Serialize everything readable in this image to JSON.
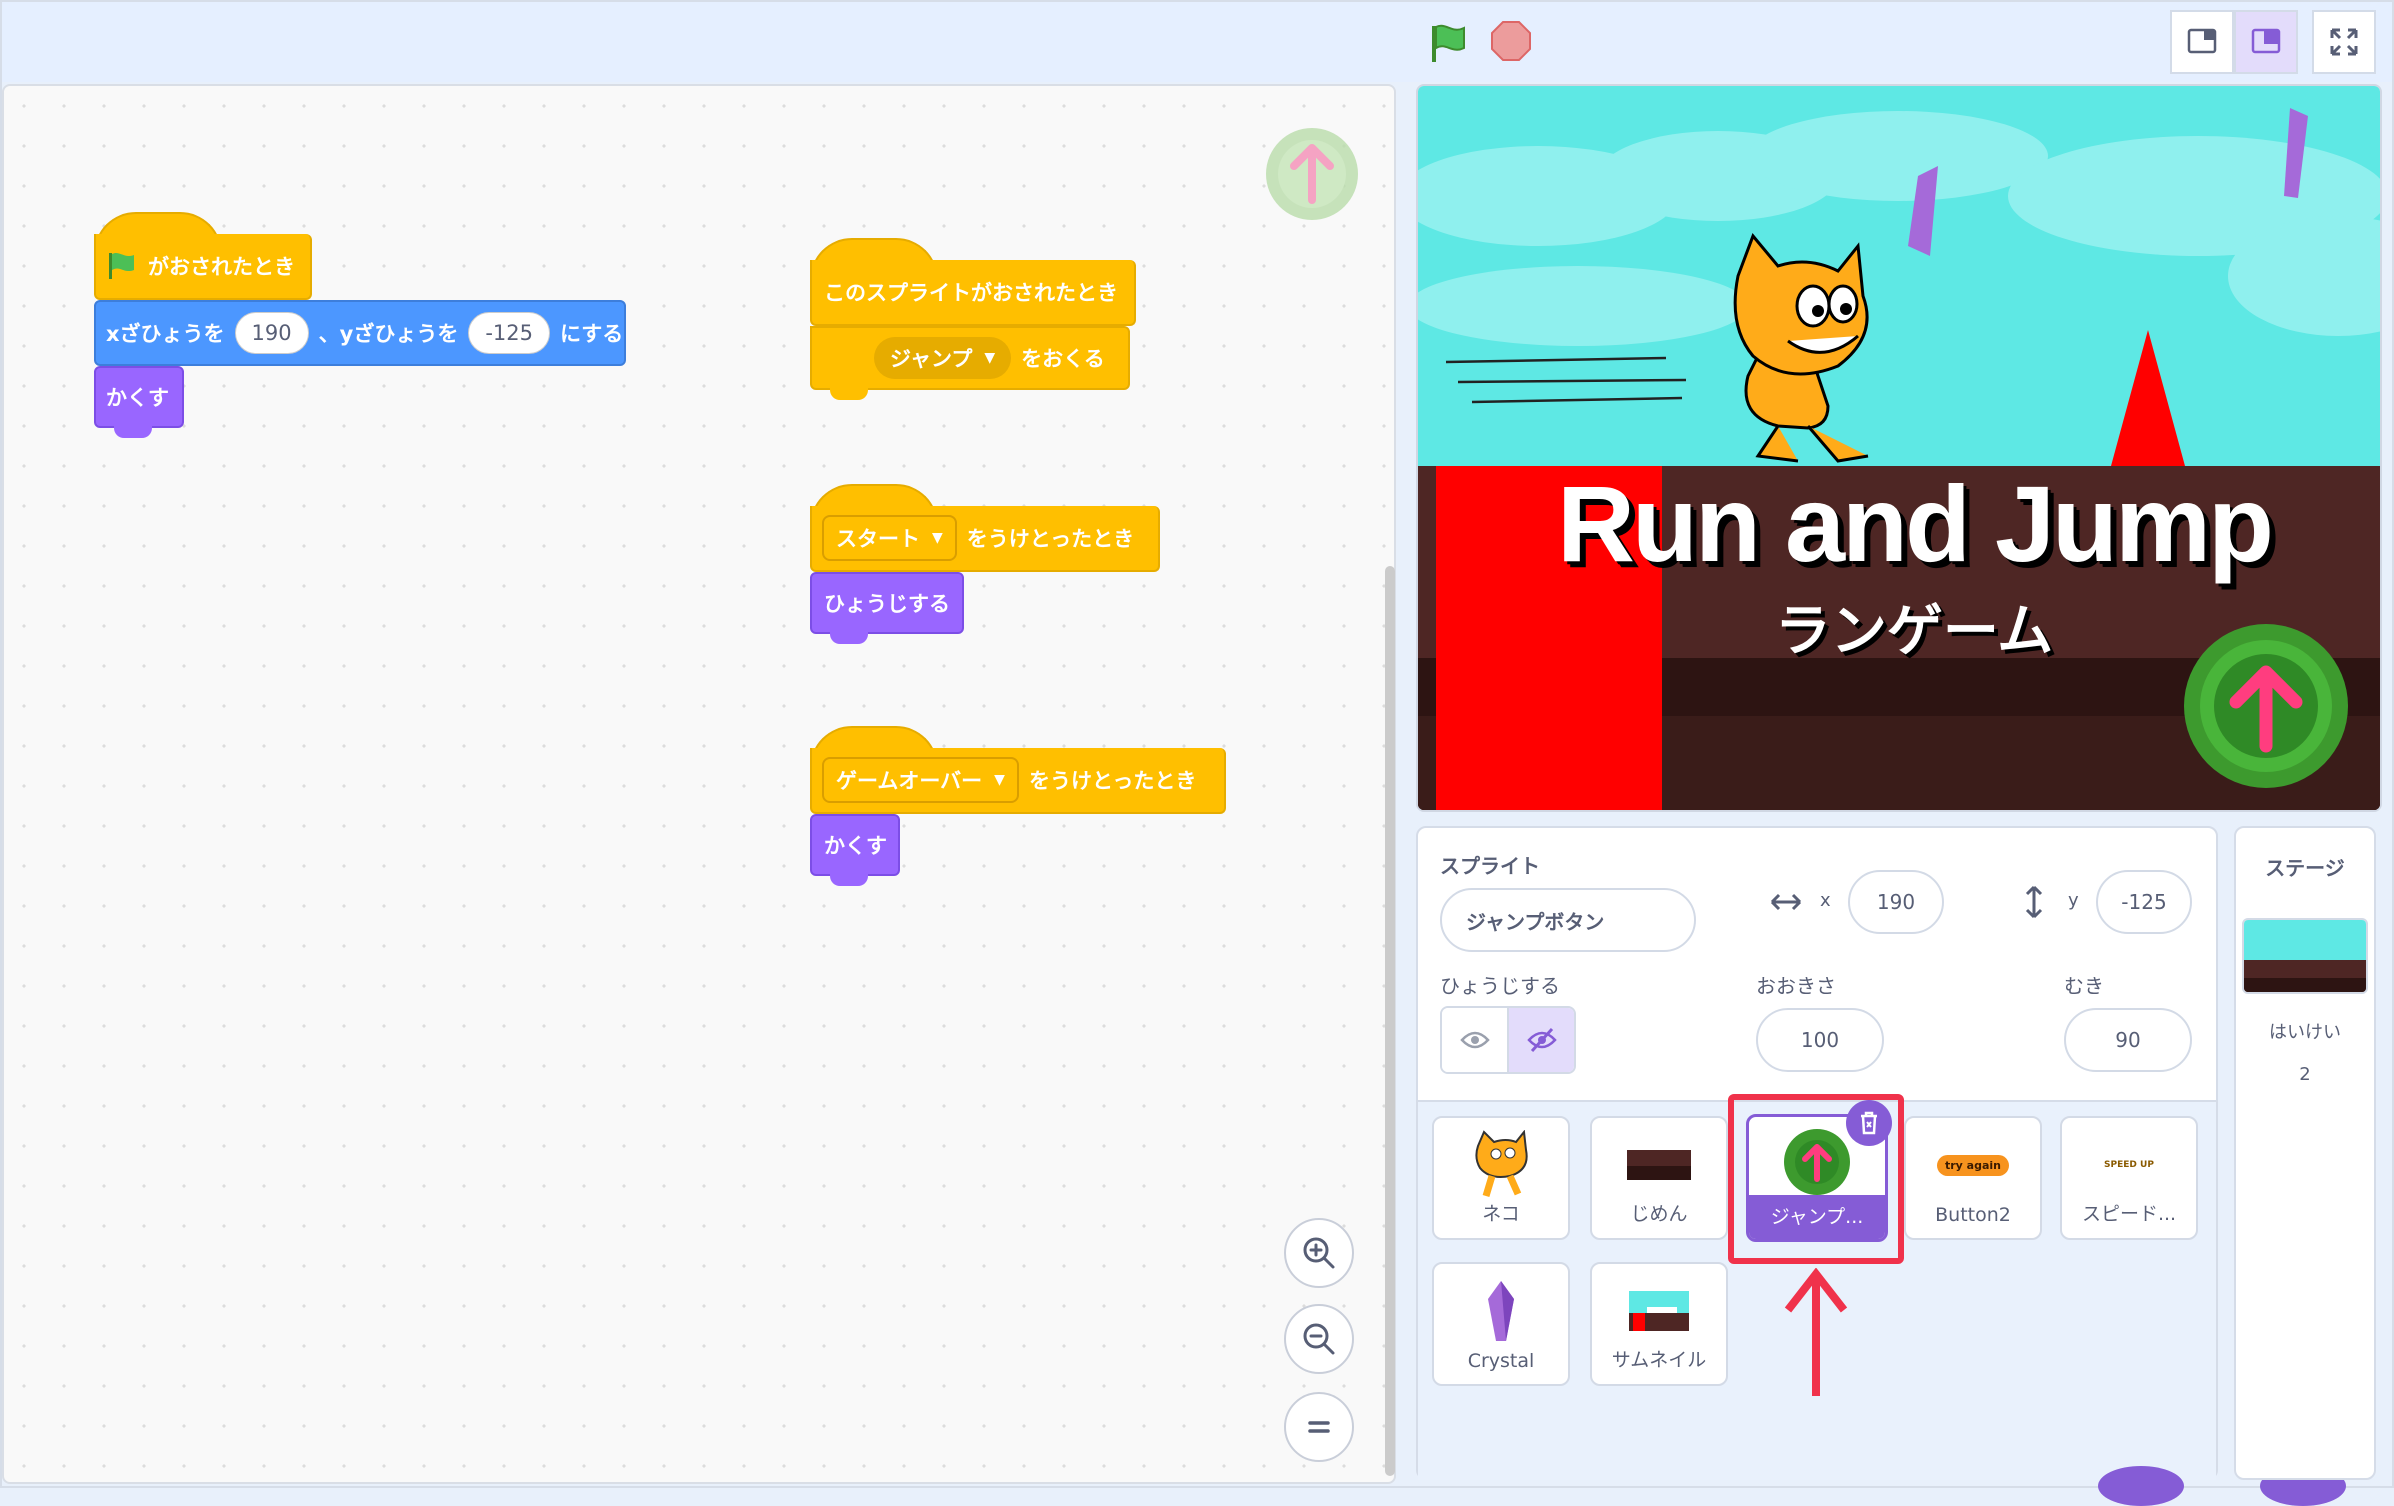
{
  "toolbar": {
    "green_flag": "green-flag",
    "stop": "stop-sign"
  },
  "code": {
    "script1": {
      "hat": "がおされたとき",
      "motion_x_label": "xざひょうを",
      "x_value": "190",
      "motion_y_label": "、yざひょうを",
      "y_value": "-125",
      "motion_end": "にする",
      "hide": "かくす"
    },
    "script2": {
      "hat": "このスプライトがおされたとき",
      "message": "ジャンプ",
      "send": "をおくる"
    },
    "script3": {
      "message": "スタート",
      "received": "をうけとったとき",
      "show": "ひょうじする"
    },
    "script4": {
      "message": "ゲームオーバー",
      "received": "をうけとったとき",
      "hide": "かくす"
    }
  },
  "stage": {
    "title": "Run and Jump",
    "subtitle": "ランゲーム"
  },
  "sprite_info": {
    "sprite_label": "スプライト",
    "sprite_name": "ジャンプボタン",
    "x_label": "x",
    "x_value": "190",
    "y_label": "y",
    "y_value": "-125",
    "show_label": "ひょうじする",
    "size_label": "おおきさ",
    "size_value": "100",
    "direction_label": "むき",
    "direction_value": "90"
  },
  "sprites": [
    {
      "name": "ネコ"
    },
    {
      "name": "じめん"
    },
    {
      "name": "ジャンプ..."
    },
    {
      "name": "Button2",
      "thumb_text": "try again"
    },
    {
      "name": "スピード...",
      "thumb_text": "SPEED UP"
    },
    {
      "name": "Crystal"
    },
    {
      "name": "サムネイル"
    }
  ],
  "stage_pane": {
    "title": "ステージ",
    "backdrop_label": "はいけい",
    "backdrop_count": "2"
  }
}
